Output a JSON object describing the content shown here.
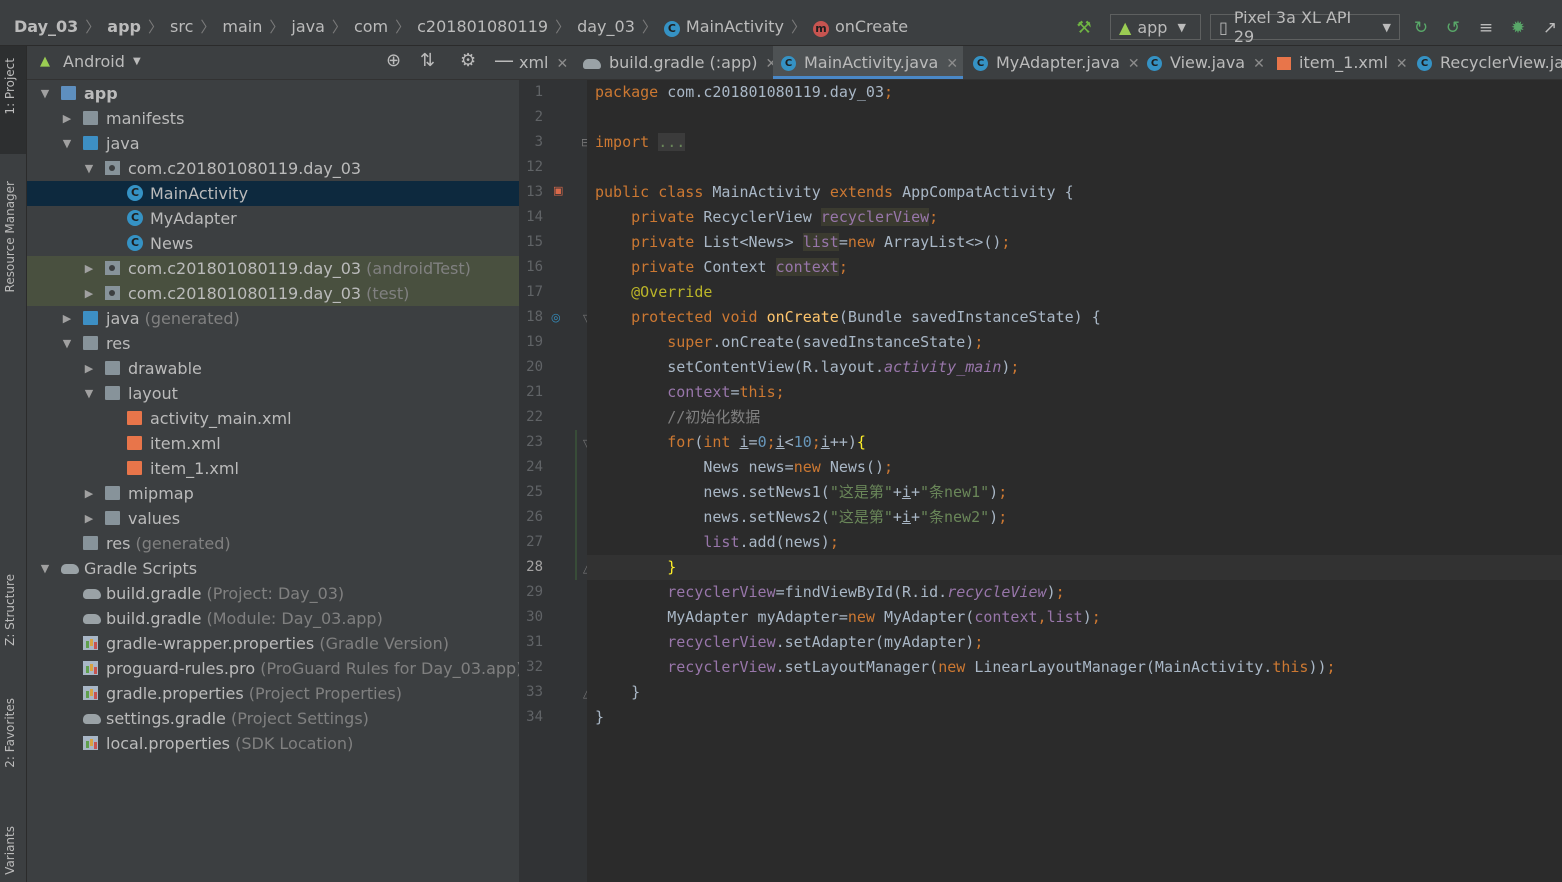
{
  "navbar": {
    "crumbs": [
      {
        "label": "Day_03",
        "bold": true
      },
      {
        "label": "app",
        "bold": true
      },
      {
        "label": "src"
      },
      {
        "label": "main"
      },
      {
        "label": "java"
      },
      {
        "label": "com"
      },
      {
        "label": "c201801080119"
      },
      {
        "label": "day_03"
      },
      {
        "label": "MainActivity",
        "icon": "class-icon"
      },
      {
        "label": "onCreate",
        "icon": "method-icon"
      }
    ],
    "run_config": "app",
    "device": "Pixel 3a XL API 29"
  },
  "left_stripe": {
    "project_tab": "1: Project",
    "resource_manager_tab": "Resource Manager",
    "structure_tab": "Z: Structure",
    "favorites_tab": "2: Favorites",
    "variants_tab": "Variants"
  },
  "project_panel": {
    "view_mode": "Android",
    "tree": [
      {
        "label": "app",
        "hint": "",
        "depth": 0,
        "expanded": true,
        "icon": "module-folder-icon",
        "bold": true
      },
      {
        "label": "manifests",
        "hint": "",
        "depth": 1,
        "expanded": false,
        "icon": "folder-icon"
      },
      {
        "label": "java",
        "hint": "",
        "depth": 1,
        "expanded": true,
        "icon": "source-folder-icon"
      },
      {
        "label": "com.c201801080119.day_03",
        "hint": "",
        "depth": 2,
        "expanded": true,
        "icon": "package-icon"
      },
      {
        "label": "MainActivity",
        "hint": "",
        "depth": 3,
        "icon": "class-icon",
        "selected": true
      },
      {
        "label": "MyAdapter",
        "hint": "",
        "depth": 3,
        "icon": "class-icon"
      },
      {
        "label": "News",
        "hint": "",
        "depth": 3,
        "icon": "class-icon"
      },
      {
        "label": "com.c201801080119.day_03",
        "hint": "(androidTest)",
        "depth": 2,
        "expanded": false,
        "icon": "package-icon",
        "test": true
      },
      {
        "label": "com.c201801080119.day_03",
        "hint": "(test)",
        "depth": 2,
        "expanded": false,
        "icon": "package-icon",
        "test": true
      },
      {
        "label": "java",
        "hint": "(generated)",
        "depth": 1,
        "expanded": false,
        "icon": "generated-folder-icon"
      },
      {
        "label": "res",
        "hint": "",
        "depth": 1,
        "expanded": true,
        "icon": "res-folder-icon"
      },
      {
        "label": "drawable",
        "hint": "",
        "depth": 2,
        "expanded": false,
        "icon": "folder-icon"
      },
      {
        "label": "layout",
        "hint": "",
        "depth": 2,
        "expanded": true,
        "icon": "folder-icon"
      },
      {
        "label": "activity_main.xml",
        "hint": "",
        "depth": 3,
        "icon": "xml-file-icon"
      },
      {
        "label": "item.xml",
        "hint": "",
        "depth": 3,
        "icon": "xml-file-icon"
      },
      {
        "label": "item_1.xml",
        "hint": "",
        "depth": 3,
        "icon": "xml-file-icon"
      },
      {
        "label": "mipmap",
        "hint": "",
        "depth": 2,
        "expanded": false,
        "icon": "folder-icon"
      },
      {
        "label": "values",
        "hint": "",
        "depth": 2,
        "expanded": false,
        "icon": "folder-icon"
      },
      {
        "label": "res",
        "hint": "(generated)",
        "depth": 1,
        "icon": "res-folder-icon"
      },
      {
        "label": "Gradle Scripts",
        "hint": "",
        "depth": 0,
        "expanded": true,
        "icon": "gradle-icon"
      },
      {
        "label": "build.gradle",
        "hint": "(Project: Day_03)",
        "depth": 1,
        "icon": "gradle-icon"
      },
      {
        "label": "build.gradle",
        "hint": "(Module: Day_03.app)",
        "depth": 1,
        "icon": "gradle-icon"
      },
      {
        "label": "gradle-wrapper.properties",
        "hint": "(Gradle Version)",
        "depth": 1,
        "icon": "properties-icon"
      },
      {
        "label": "proguard-rules.pro",
        "hint": "(ProGuard Rules for Day_03.app)",
        "depth": 1,
        "icon": "properties-icon"
      },
      {
        "label": "gradle.properties",
        "hint": "(Project Properties)",
        "depth": 1,
        "icon": "properties-icon"
      },
      {
        "label": "settings.gradle",
        "hint": "(Project Settings)",
        "depth": 1,
        "icon": "gradle-icon"
      },
      {
        "label": "local.properties",
        "hint": "(SDK Location)",
        "depth": 1,
        "icon": "properties-icon"
      }
    ]
  },
  "editor_tabs": [
    {
      "label": "xml",
      "icon": "none",
      "active": false
    },
    {
      "label": "build.gradle (:app)",
      "icon": "gradle-icon",
      "active": false
    },
    {
      "label": "MainActivity.java",
      "icon": "class-icon",
      "active": true
    },
    {
      "label": "MyAdapter.java",
      "icon": "class-icon",
      "active": false
    },
    {
      "label": "View.java",
      "icon": "class-icon",
      "active": false
    },
    {
      "label": "item_1.xml",
      "icon": "xml-file-icon",
      "active": false
    },
    {
      "label": "RecyclerView.jav",
      "icon": "class-icon",
      "active": false
    }
  ],
  "editor": {
    "current_line": "28",
    "lines": [
      {
        "n": "1",
        "html": "<span class='kw'>package </span>com.c201801080119.day_03<span class='kw'>;</span>"
      },
      {
        "n": "2",
        "html": ""
      },
      {
        "n": "3",
        "html": "<span class='kw'>import </span><span class='fold'>...</span>"
      },
      {
        "n": "12",
        "html": ""
      },
      {
        "n": "13",
        "html": "<span class='kw'>public class </span>MainActivity <span class='kw'>extends </span>AppCompatActivity {"
      },
      {
        "n": "14",
        "html": "    <span class='kw'>private </span>RecyclerView <span class='fld uhl'>recyclerView</span><span class='kw'>;</span>"
      },
      {
        "n": "15",
        "html": "    <span class='kw'>private </span>List&lt;News&gt; <span class='fld uhl'>list</span>=<span class='kw'>new </span>ArrayList&lt;&gt;()<span class='kw'>;</span>"
      },
      {
        "n": "16",
        "html": "    <span class='kw'>private </span>Context <span class='fld uhl'>context</span><span class='kw'>;</span>"
      },
      {
        "n": "17",
        "html": "    <span class='ann'>@Override</span>"
      },
      {
        "n": "18",
        "html": "    <span class='kw'>protected void </span><span style='color:#ffc66d'>onCreate</span>(Bundle savedInstanceState) {"
      },
      {
        "n": "19",
        "html": "        <span class='kw'>super</span>.onCreate(savedInstanceState)<span class='kw'>;</span>"
      },
      {
        "n": "20",
        "html": "        setContentView(R.layout.<span class='fld it'>activity_main</span>)<span class='kw'>;</span>"
      },
      {
        "n": "21",
        "html": "        <span class='fld'>context</span>=<span class='kw'>this;</span>"
      },
      {
        "n": "22",
        "html": "        <span class='cmt'>//初始化数据</span>"
      },
      {
        "n": "23",
        "html": "        <span class='kw'>for</span>(<span class='kw'>int </span><u>i</u>=<span style='color:#6897bb'>0</span><span class='kw'>;</span><u>i</u>&lt;<span style='color:#6897bb'>10</span><span class='kw'>;</span><u>i</u>++)<span style='color:#ffef28'>{</span>"
      },
      {
        "n": "24",
        "html": "            News news=<span class='kw'>new </span>News()<span class='kw'>;</span>"
      },
      {
        "n": "25",
        "html": "            news.setNews1(<span class='str'>\"这是第\"</span>+<u>i</u>+<span class='str'>\"条new1\"</span>)<span class='kw'>;</span>"
      },
      {
        "n": "26",
        "html": "            news.setNews2(<span class='str'>\"这是第\"</span>+<u>i</u>+<span class='str'>\"条new2\"</span>)<span class='kw'>;</span>"
      },
      {
        "n": "27",
        "html": "            <span class='fld'>list</span>.add(news)<span class='kw'>;</span>"
      },
      {
        "n": "28",
        "html": "        <span style='color:#ffef28'>}</span>"
      },
      {
        "n": "29",
        "html": "        <span class='fld'>recyclerView</span>=findViewById(R.id.<span class='fld it'>recycleView</span>)<span class='kw'>;</span>"
      },
      {
        "n": "30",
        "html": "        MyAdapter myAdapter=<span class='kw'>new </span>MyAdapter(<span class='fld'>context</span><span class='kw'>,</span><span class='fld'>list</span>)<span class='kw'>;</span>"
      },
      {
        "n": "31",
        "html": "        <span class='fld'>recyclerView</span>.setAdapter(myAdapter)<span class='kw'>;</span>"
      },
      {
        "n": "32",
        "html": "        <span class='fld'>recyclerView</span>.setLayoutManager(<span class='kw'>new </span>LinearLayoutManager(MainActivity.<span class='kw'>this</span>))<span class='kw'>;</span>"
      },
      {
        "n": "33",
        "html": "    }"
      },
      {
        "n": "34",
        "html": "}"
      }
    ]
  }
}
